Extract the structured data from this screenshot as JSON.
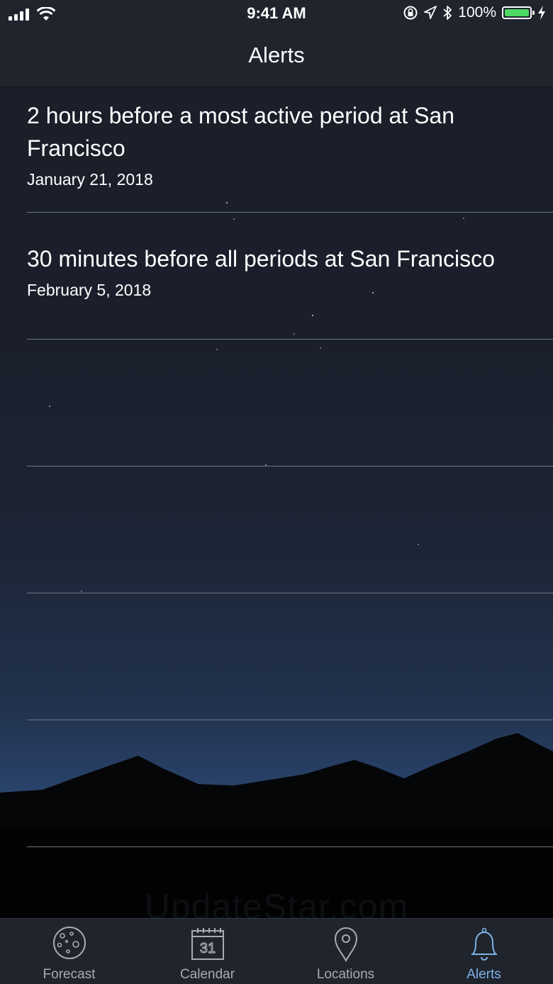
{
  "status_bar": {
    "time": "9:41 AM",
    "battery_percent": "100%",
    "battery_level": 1.0,
    "icons": [
      "signal-icon",
      "wifi-icon",
      "orientation-lock-icon",
      "location-arrow-icon",
      "bluetooth-icon",
      "battery-icon",
      "charging-icon"
    ]
  },
  "nav": {
    "title": "Alerts"
  },
  "alerts": [
    {
      "title": "2 hours before a most active period at San Francisco",
      "date": "January 21, 2018"
    },
    {
      "title": "30 minutes before all periods at San Francisco",
      "date": "February 5, 2018"
    }
  ],
  "watermark": "UpdateStar.com",
  "tabs": [
    {
      "label": "Forecast",
      "icon": "moon-icon",
      "active": false
    },
    {
      "label": "Calendar",
      "icon": "calendar-icon",
      "active": false
    },
    {
      "label": "Locations",
      "icon": "map-pin-icon",
      "active": false
    },
    {
      "label": "Alerts",
      "icon": "bell-icon",
      "active": true
    }
  ],
  "colors": {
    "accent": "#7fb2e6",
    "bar_bg": "#1f242d",
    "battery": "#4cd964"
  }
}
